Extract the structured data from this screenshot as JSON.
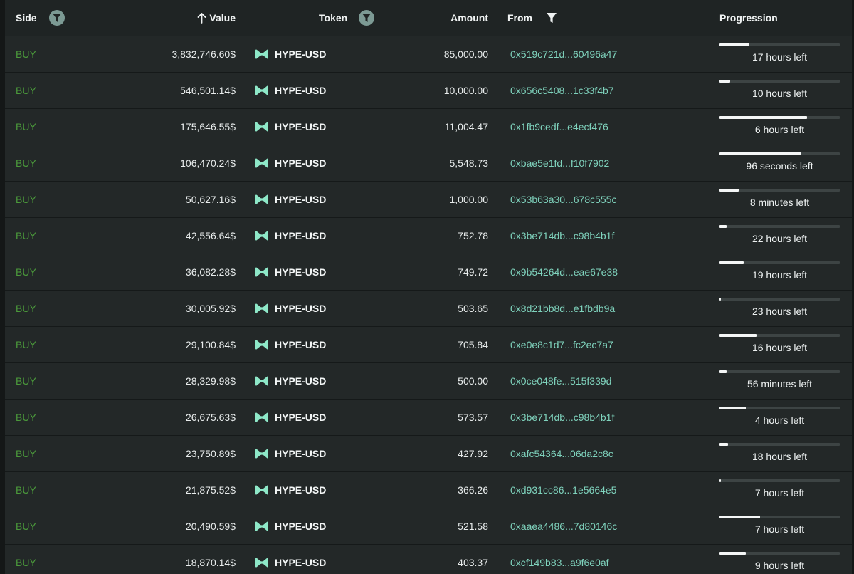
{
  "header": {
    "side": "Side",
    "value": "Value",
    "token": "Token",
    "amount": "Amount",
    "from": "From",
    "progression": "Progression"
  },
  "colors": {
    "buy": "#4b9a3b",
    "address": "#7fd3bd",
    "token_icon": "#8ee8c8",
    "filter_active": "#7c9a94"
  },
  "icons": {
    "sort": "arrow-up-icon",
    "filter": "filter-icon",
    "token": "hyperliquid-logo-icon"
  },
  "rows": [
    {
      "side": "BUY",
      "value": "3,832,746.60$",
      "token": "HYPE-USD",
      "amount": "85,000.00",
      "from": "0x519c721d...60496a47",
      "progress": 0.25,
      "time_left": "17 hours left"
    },
    {
      "side": "BUY",
      "value": "546,501.14$",
      "token": "HYPE-USD",
      "amount": "10,000.00",
      "from": "0x656c5408...1c33f4b7",
      "progress": 0.09,
      "time_left": "10 hours left"
    },
    {
      "side": "BUY",
      "value": "175,646.55$",
      "token": "HYPE-USD",
      "amount": "11,004.47",
      "from": "0x1fb9cedf...e4ecf476",
      "progress": 0.73,
      "time_left": "6 hours left"
    },
    {
      "side": "BUY",
      "value": "106,470.24$",
      "token": "HYPE-USD",
      "amount": "5,548.73",
      "from": "0xbae5e1fd...f10f7902",
      "progress": 0.68,
      "time_left": "96 seconds left"
    },
    {
      "side": "BUY",
      "value": "50,627.16$",
      "token": "HYPE-USD",
      "amount": "1,000.00",
      "from": "0x53b63a30...678c555c",
      "progress": 0.16,
      "time_left": "8 minutes left"
    },
    {
      "side": "BUY",
      "value": "42,556.64$",
      "token": "HYPE-USD",
      "amount": "752.78",
      "from": "0x3be714db...c98b4b1f",
      "progress": 0.06,
      "time_left": "22 hours left"
    },
    {
      "side": "BUY",
      "value": "36,082.28$",
      "token": "HYPE-USD",
      "amount": "749.72",
      "from": "0x9b54264d...eae67e38",
      "progress": 0.2,
      "time_left": "19 hours left"
    },
    {
      "side": "BUY",
      "value": "30,005.92$",
      "token": "HYPE-USD",
      "amount": "503.65",
      "from": "0x8d21bb8d...e1fbdb9a",
      "progress": 0.01,
      "time_left": "23 hours left"
    },
    {
      "side": "BUY",
      "value": "29,100.84$",
      "token": "HYPE-USD",
      "amount": "705.84",
      "from": "0xe0e8c1d7...fc2ec7a7",
      "progress": 0.31,
      "time_left": "16 hours left"
    },
    {
      "side": "BUY",
      "value": "28,329.98$",
      "token": "HYPE-USD",
      "amount": "500.00",
      "from": "0x0ce048fe...515f339d",
      "progress": 0.06,
      "time_left": "56 minutes left"
    },
    {
      "side": "BUY",
      "value": "26,675.63$",
      "token": "HYPE-USD",
      "amount": "573.57",
      "from": "0x3be714db...c98b4b1f",
      "progress": 0.22,
      "time_left": "4 hours left"
    },
    {
      "side": "BUY",
      "value": "23,750.89$",
      "token": "HYPE-USD",
      "amount": "427.92",
      "from": "0xafc54364...06da2c8c",
      "progress": 0.07,
      "time_left": "18 hours left"
    },
    {
      "side": "BUY",
      "value": "21,875.52$",
      "token": "HYPE-USD",
      "amount": "366.26",
      "from": "0xd931cc86...1e5664e5",
      "progress": 0.01,
      "time_left": "7 hours left"
    },
    {
      "side": "BUY",
      "value": "20,490.59$",
      "token": "HYPE-USD",
      "amount": "521.58",
      "from": "0xaaea4486...7d80146c",
      "progress": 0.34,
      "time_left": "7 hours left"
    },
    {
      "side": "BUY",
      "value": "18,870.14$",
      "token": "HYPE-USD",
      "amount": "403.37",
      "from": "0xcf149b83...a9f6e0af",
      "progress": 0.22,
      "time_left": "9 hours left"
    }
  ]
}
